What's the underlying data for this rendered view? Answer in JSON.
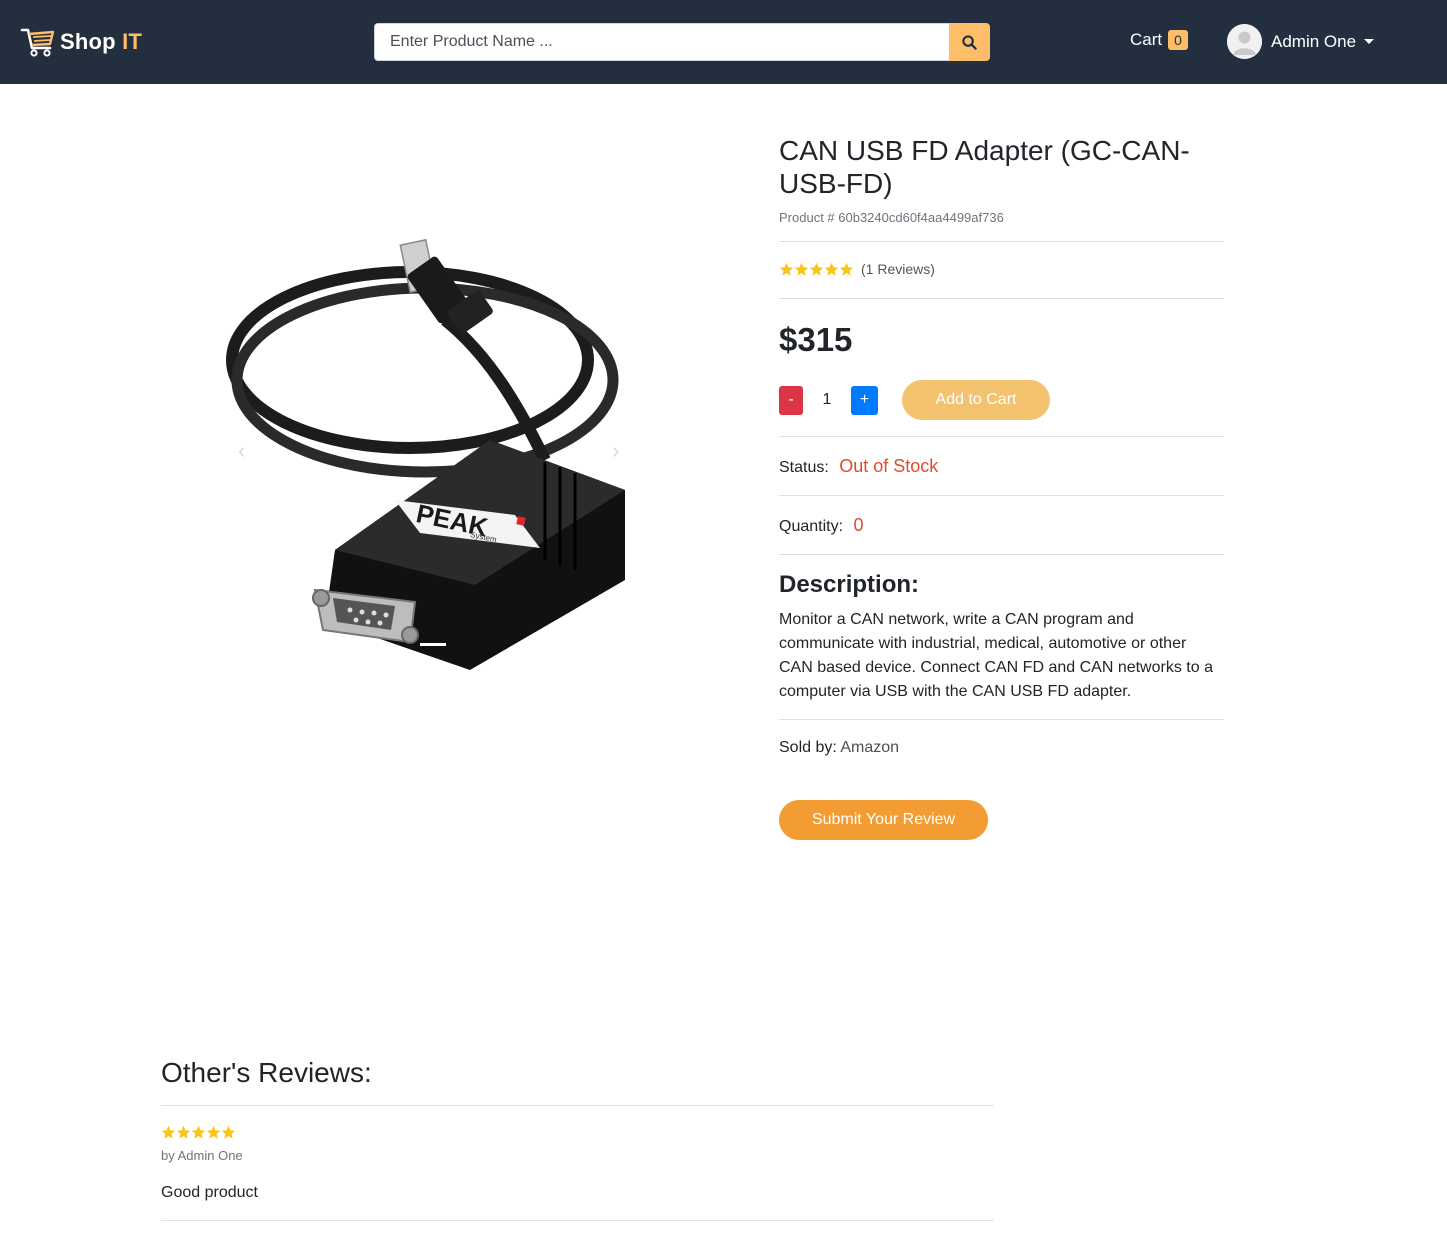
{
  "header": {
    "logo_text_main": "Shop",
    "logo_text_accent": "IT",
    "search_placeholder": "Enter Product Name ...",
    "cart_label": "Cart",
    "cart_count": "0",
    "user_name": "Admin One"
  },
  "product": {
    "title": "CAN USB FD Adapter (GC-CAN-USB-FD)",
    "id_text": "Product # 60b3240cd60f4aa4499af736",
    "rating": 5,
    "reviews_text": "(1 Reviews)",
    "price": "$315",
    "quantity": "1",
    "minus_label": "-",
    "plus_label": "+",
    "add_to_cart_label": "Add to Cart",
    "status_label": "Status:",
    "status_value": "Out of Stock",
    "quantity_label": "Quantity:",
    "quantity_value": "0",
    "description_heading": "Description:",
    "description": "Monitor a CAN network, write a CAN program and communicate with industrial, medical, automotive or other CAN based device. Connect CAN FD and CAN networks to a computer via USB with the CAN USB FD adapter.",
    "sold_by_label": "Sold by:",
    "seller": "Amazon",
    "submit_review_label": "Submit Your Review",
    "image_brand_text": "PEAK",
    "image_brand_sub": "System"
  },
  "reviews": {
    "heading": "Other's Reviews:",
    "items": [
      {
        "rating": 5,
        "author": "by Admin One",
        "comment": "Good product"
      }
    ]
  },
  "colors": {
    "navbar": "#232f3e",
    "accent": "#febd69",
    "danger": "#dc3545",
    "primary": "#007bff",
    "status_red": "#e04c2b",
    "review_button": "#f39c33",
    "star": "#fcc419"
  }
}
